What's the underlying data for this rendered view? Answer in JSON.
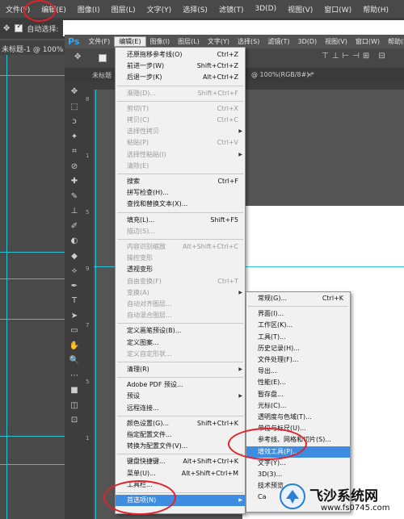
{
  "outer": {
    "menubar": [
      "文件(F)",
      "编辑(E)",
      "图像(I)",
      "图层(L)",
      "文字(Y)",
      "选择(S)",
      "滤镜(T)",
      "3D(D)",
      "视图(V)",
      "窗口(W)",
      "帮助(H)"
    ],
    "auto_select_label": "自动选择:",
    "doc_tab": "未标题-1 @ 100% ("
  },
  "inner": {
    "logo": "Ps",
    "menubar": [
      "文件(F)",
      "编辑(E)",
      "图像(I)",
      "图层(L)",
      "文字(Y)",
      "选择(S)",
      "滤镜(T)",
      "3D(D)",
      "视图(V)",
      "窗口(W)",
      "帮助(H)"
    ],
    "doc_tab_left": "未标题",
    "doc_tab_right": "@ 100%(RGB/8#) *",
    "doc_tab_close": "×",
    "tools": [
      "✥",
      "⬚",
      "ↄ",
      "✦",
      "⌗",
      "⊘",
      "✚",
      "✎",
      "⊥",
      "✐",
      "◐",
      "◆",
      "⟡",
      "✒",
      "T",
      "➤",
      "▭",
      "✋",
      "🔍",
      "⋯",
      "■",
      "◫",
      "⊡"
    ],
    "ruler_numbers": [
      "8",
      "1",
      "5",
      "9",
      "7",
      "5",
      "1"
    ]
  },
  "edit_menu": {
    "items": [
      {
        "label": "还原拖移参考线(O)",
        "shortcut": "Ctrl+Z",
        "disabled": false,
        "submenu": false
      },
      {
        "label": "前进一步(W)",
        "shortcut": "Shift+Ctrl+Z",
        "disabled": false,
        "submenu": false
      },
      {
        "label": "后退一步(K)",
        "shortcut": "Alt+Ctrl+Z",
        "disabled": false,
        "submenu": false
      },
      {
        "label": "渐隐(D)...",
        "shortcut": "Shift+Ctrl+F",
        "disabled": true,
        "submenu": false
      },
      {
        "label": "剪切(T)",
        "shortcut": "Ctrl+X",
        "disabled": true,
        "submenu": false
      },
      {
        "label": "拷贝(C)",
        "shortcut": "Ctrl+C",
        "disabled": true,
        "submenu": false
      },
      {
        "label": "选择性拷贝",
        "shortcut": "",
        "disabled": true,
        "submenu": true
      },
      {
        "label": "粘贴(P)",
        "shortcut": "Ctrl+V",
        "disabled": true,
        "submenu": false
      },
      {
        "label": "选择性粘贴(I)",
        "shortcut": "",
        "disabled": true,
        "submenu": true
      },
      {
        "label": "清除(E)",
        "shortcut": "",
        "disabled": true,
        "submenu": false
      },
      {
        "label": "搜索",
        "shortcut": "Ctrl+F",
        "disabled": false,
        "submenu": false
      },
      {
        "label": "拼写检查(H)...",
        "shortcut": "",
        "disabled": false,
        "submenu": false
      },
      {
        "label": "查找和替换文本(X)...",
        "shortcut": "",
        "disabled": false,
        "submenu": false
      },
      {
        "label": "填充(L)...",
        "shortcut": "Shift+F5",
        "disabled": false,
        "submenu": false
      },
      {
        "label": "描边(S)...",
        "shortcut": "",
        "disabled": true,
        "submenu": false
      },
      {
        "label": "内容识别缩放",
        "shortcut": "Alt+Shift+Ctrl+C",
        "disabled": true,
        "submenu": false
      },
      {
        "label": "操控变形",
        "shortcut": "",
        "disabled": true,
        "submenu": false
      },
      {
        "label": "透视变形",
        "shortcut": "",
        "disabled": false,
        "submenu": false
      },
      {
        "label": "自由变换(F)",
        "shortcut": "Ctrl+T",
        "disabled": true,
        "submenu": false
      },
      {
        "label": "变换(A)",
        "shortcut": "",
        "disabled": true,
        "submenu": true
      },
      {
        "label": "自动对齐图层...",
        "shortcut": "",
        "disabled": true,
        "submenu": false
      },
      {
        "label": "自动混合图层...",
        "shortcut": "",
        "disabled": true,
        "submenu": false
      },
      {
        "label": "定义画笔预设(B)...",
        "shortcut": "",
        "disabled": false,
        "submenu": false
      },
      {
        "label": "定义图案...",
        "shortcut": "",
        "disabled": false,
        "submenu": false
      },
      {
        "label": "定义自定形状...",
        "shortcut": "",
        "disabled": true,
        "submenu": false
      },
      {
        "label": "清理(R)",
        "shortcut": "",
        "disabled": false,
        "submenu": true
      },
      {
        "label": "Adobe PDF 预设...",
        "shortcut": "",
        "disabled": false,
        "submenu": false
      },
      {
        "label": "预设",
        "shortcut": "",
        "disabled": false,
        "submenu": true
      },
      {
        "label": "远程连接...",
        "shortcut": "",
        "disabled": false,
        "submenu": false
      },
      {
        "label": "颜色设置(G)...",
        "shortcut": "Shift+Ctrl+K",
        "disabled": false,
        "submenu": false
      },
      {
        "label": "指定配置文件...",
        "shortcut": "",
        "disabled": false,
        "submenu": false
      },
      {
        "label": "转换为配置文件(V)...",
        "shortcut": "",
        "disabled": false,
        "submenu": false
      },
      {
        "label": "键盘快捷键...",
        "shortcut": "Alt+Shift+Ctrl+K",
        "disabled": false,
        "submenu": false
      },
      {
        "label": "菜单(U)...",
        "shortcut": "Alt+Shift+Ctrl+M",
        "disabled": false,
        "submenu": false
      },
      {
        "label": "工具栏...",
        "shortcut": "",
        "disabled": false,
        "submenu": false
      },
      {
        "label": "首选项(N)",
        "shortcut": "",
        "disabled": false,
        "submenu": true,
        "highlighted": true
      }
    ]
  },
  "prefs_submenu": {
    "items": [
      {
        "label": "常规(G)...",
        "shortcut": "Ctrl+K"
      },
      {
        "label": "界面(I)...",
        "shortcut": ""
      },
      {
        "label": "工作区(K)...",
        "shortcut": ""
      },
      {
        "label": "工具(T)...",
        "shortcut": ""
      },
      {
        "label": "历史记录(H)...",
        "shortcut": ""
      },
      {
        "label": "文件处理(F)...",
        "shortcut": ""
      },
      {
        "label": "导出...",
        "shortcut": ""
      },
      {
        "label": "性能(E)...",
        "shortcut": ""
      },
      {
        "label": "暂存盘...",
        "shortcut": ""
      },
      {
        "label": "光标(C)...",
        "shortcut": ""
      },
      {
        "label": "透明度与色域(T)...",
        "shortcut": ""
      },
      {
        "label": "单位与标尺(U)...",
        "shortcut": ""
      },
      {
        "label": "参考线、网格和切片(S)...",
        "shortcut": ""
      },
      {
        "label": "增效工具(P)...",
        "shortcut": "",
        "highlighted": true
      },
      {
        "label": "文字(Y)...",
        "shortcut": ""
      },
      {
        "label": "3D(3)...",
        "shortcut": ""
      },
      {
        "label": "技术预览...",
        "shortcut": ""
      },
      {
        "label": "Ca",
        "shortcut": ""
      }
    ]
  },
  "watermark": {
    "title": "飞沙系统网",
    "url": "www.fs0745.com"
  },
  "colors": {
    "highlight": "#3e8de0",
    "guide": "#2ec4d4",
    "annotation": "#e4202a"
  }
}
